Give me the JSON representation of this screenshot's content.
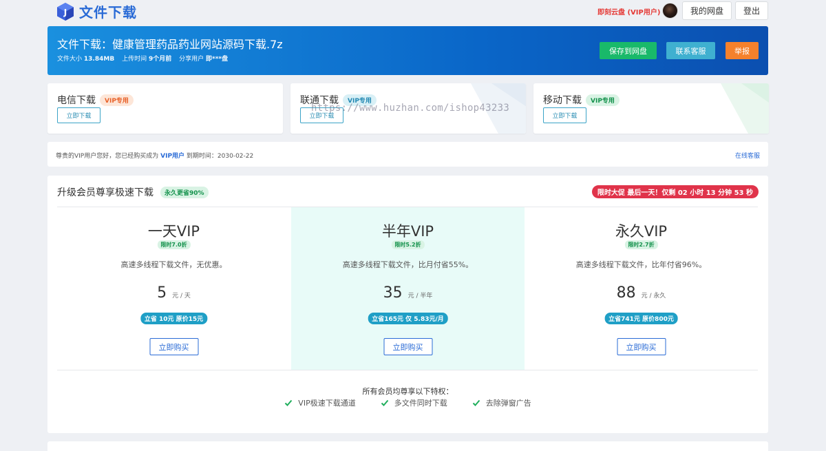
{
  "header": {
    "logo_text": "文件下载",
    "vip_tag": "即刻云盘 (VIP用户)",
    "netdisk_label": "我的网盘",
    "logout_label": "登出"
  },
  "banner": {
    "title": "文件下载：健康管理药品药业网站源码下载.7z",
    "size_label": "文件大小",
    "size_value": "13.84MB",
    "time_label": "上传时间",
    "time_value": "9个月前",
    "user_label": "分享用户",
    "user_value": "即***盘",
    "save_label": "保存到网盘",
    "service_label": "联系客服",
    "report_label": "举报"
  },
  "carriers": [
    {
      "title": "电信下载",
      "badge": "VIP专用",
      "button": "立即下载"
    },
    {
      "title": "联通下载",
      "badge": "VIP专用",
      "button": "立即下载"
    },
    {
      "title": "移动下载",
      "badge": "VIP专用",
      "button": "立即下载"
    }
  ],
  "watermark": "https://www.huzhan.com/ishop43233",
  "notice": {
    "prefix": "尊贵的VIP用户您好，您已经购买成为",
    "vip": "VIP用户",
    "suffix": "到期时间：2030-02-22",
    "link": "在线客服"
  },
  "upgrade": {
    "title": "升级会员尊享极速下载",
    "badge": "永久更省90%",
    "countdown": "限时大促 最后一天！仅剩 02 小时 13 分钟 53 秒",
    "plans": [
      {
        "name": "一天VIP",
        "off": "限时7.0折",
        "desc": "高速多线程下载文件，无优惠。",
        "price": "5",
        "unit": "元 / 天",
        "save": "立省 10元 原价15元",
        "buy": "立即购买"
      },
      {
        "name": "半年VIP",
        "off": "限时5.2折",
        "desc": "高速多线程下载文件，比月付省55%。",
        "price": "35",
        "unit": "元 / 半年",
        "save": "立省165元 仅 5.83元/月",
        "buy": "立即购买"
      },
      {
        "name": "永久VIP",
        "off": "限时2.7折",
        "desc": "高速多线程下载文件，比年付省96%。",
        "price": "88",
        "unit": "元 / 永久",
        "save": "立省741元 原价800元",
        "buy": "立即购买"
      }
    ],
    "perks_title": "所有会员均尊享以下特权：",
    "perks": [
      "VIP极速下载通道",
      "多文件同时下载",
      "去除弹窗广告"
    ]
  },
  "colors": {
    "brand": "#2a6bd6",
    "save_green": "#19b96a",
    "service_teal": "#3fb0d0",
    "report_orange": "#f5812c",
    "countdown_red": "#e0334a",
    "highlight_plan_bg": "#e8fbf8"
  }
}
